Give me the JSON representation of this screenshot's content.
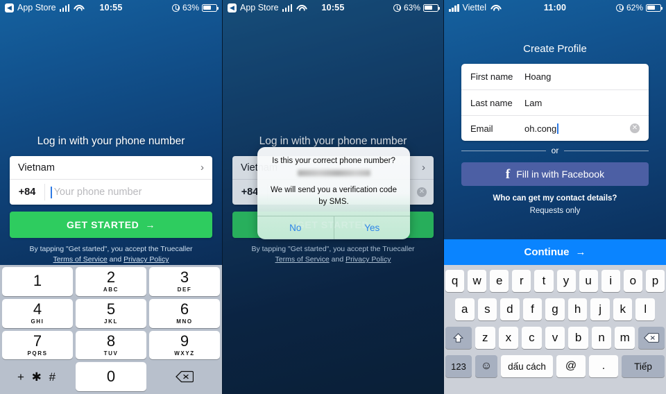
{
  "panels": [
    {
      "id": "login-keypad",
      "status_bar": {
        "back_label": "App Store",
        "back_icon": "chevron-left-icon",
        "signal_icon": "signal-bars-icon",
        "wifi_icon": "wifi-icon",
        "time": "10:55",
        "lock_icon": "orientation-lock-icon",
        "battery_pct": "63%",
        "battery_icon": "battery-icon"
      },
      "login": {
        "title": "Log in with your phone number",
        "country": "Vietnam",
        "country_chevron": "chevron-right-icon",
        "dial_code": "+84",
        "phone_placeholder": "Your phone number",
        "phone_value": "",
        "cta": "GET STARTED",
        "cta_arrow": "arrow-right-icon",
        "legal_line1": "By tapping \"Get started\", you accept the Truecaller",
        "legal_terms": "Terms of Service",
        "legal_and": " and ",
        "legal_privacy": "Privacy Policy"
      },
      "keypad": {
        "keys": [
          {
            "digit": "1",
            "letters": ""
          },
          {
            "digit": "2",
            "letters": "ABC"
          },
          {
            "digit": "3",
            "letters": "DEF"
          },
          {
            "digit": "4",
            "letters": "GHI"
          },
          {
            "digit": "5",
            "letters": "JKL"
          },
          {
            "digit": "6",
            "letters": "MNO"
          },
          {
            "digit": "7",
            "letters": "PQRS"
          },
          {
            "digit": "8",
            "letters": "TUV"
          },
          {
            "digit": "9",
            "letters": "WXYZ"
          }
        ],
        "symbol_key": "+ ✱ #",
        "zero_key": "0",
        "delete_icon": "backspace-icon"
      }
    },
    {
      "id": "confirm-dialog",
      "status_bar": {
        "back_label": "App Store",
        "back_icon": "chevron-left-icon",
        "signal_icon": "signal-bars-icon",
        "wifi_icon": "wifi-icon",
        "time": "10:55",
        "lock_icon": "orientation-lock-icon",
        "battery_pct": "63%",
        "battery_icon": "battery-icon"
      },
      "login": {
        "title": "Log in with your phone number",
        "country": "Vietnam",
        "dial_code": "+84",
        "cta": "GET STARTED",
        "legal_line1": "By tapping \"Get started\", you accept the Truecaller",
        "legal_terms": "Terms of Service",
        "legal_and": " and ",
        "legal_privacy": "Privacy Policy"
      },
      "dialog": {
        "question": "Is this your correct phone number?",
        "number_redacted": "",
        "message": "We will send you a verification code by SMS.",
        "no_label": "No",
        "yes_label": "Yes"
      }
    },
    {
      "id": "create-profile",
      "status_bar": {
        "carrier": "Viettel",
        "signal_icon": "signal-bars-icon",
        "wifi_icon": "wifi-icon",
        "time": "11:00",
        "lock_icon": "orientation-lock-icon",
        "battery_pct": "62%",
        "battery_icon": "battery-icon"
      },
      "profile": {
        "title": "Create Profile",
        "fields": [
          {
            "label": "First name",
            "value": "Hoang"
          },
          {
            "label": "Last name",
            "value": "Lam"
          },
          {
            "label": "Email",
            "value": "oh.cong"
          }
        ],
        "avatar_icon": "camera-icon",
        "clear_icon": "clear-field-icon",
        "or_label": "or",
        "facebook_button": "Fill in with Facebook",
        "facebook_icon": "facebook-icon",
        "contact_question": "Who can get my contact details?",
        "contact_answer": "Requests only",
        "continue_label": "Continue",
        "continue_arrow": "arrow-right-icon"
      },
      "keyboard": {
        "row1": [
          "q",
          "w",
          "e",
          "r",
          "t",
          "y",
          "u",
          "i",
          "o",
          "p"
        ],
        "row2": [
          "a",
          "s",
          "d",
          "f",
          "g",
          "h",
          "j",
          "k",
          "l"
        ],
        "row3": [
          "z",
          "x",
          "c",
          "v",
          "b",
          "n",
          "m"
        ],
        "shift_icon": "shift-icon",
        "backspace_icon": "backspace-icon",
        "numbers_key": "123",
        "emoji_icon": "emoji-icon",
        "space_key": "dấu cách",
        "at_key": "@",
        "dot_key": ".",
        "next_key": "Tiếp"
      }
    }
  ],
  "colors": {
    "bg_top": "#15619f",
    "bg_bottom": "#0a2848",
    "green_cta": "#2ecc5f",
    "blue_cta": "#0a84ff",
    "facebook": "#4c5fa4",
    "keypad_bg": "#b8c0cc",
    "keyboard_bg": "#ccd0d8"
  }
}
